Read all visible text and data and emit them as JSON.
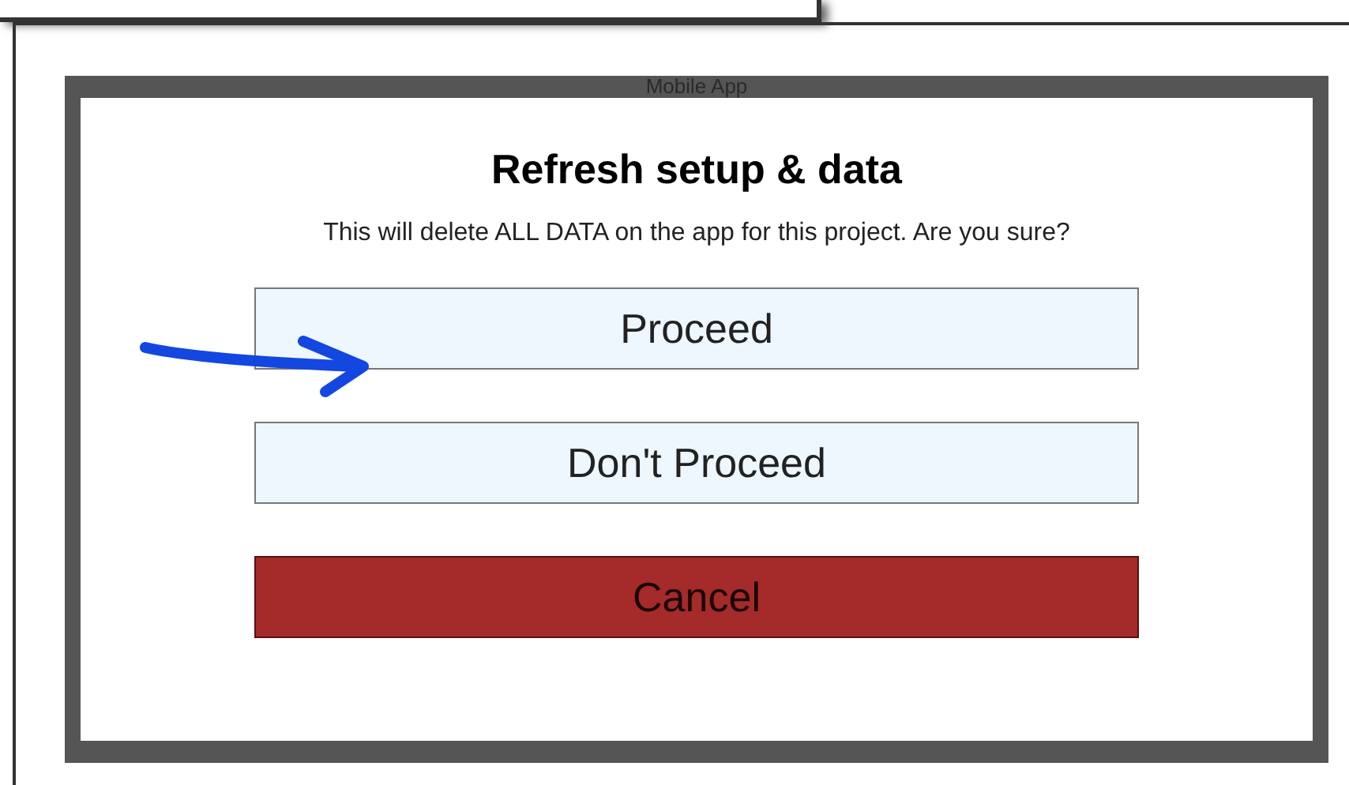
{
  "window": {
    "title": "Mobile App"
  },
  "dialog": {
    "title": "Refresh setup & data",
    "message": "This will delete ALL DATA on the app for this project. Are you sure?",
    "buttons": [
      {
        "label": "Proceed",
        "kind": "default"
      },
      {
        "label": "Don't Proceed",
        "kind": "default"
      },
      {
        "label": "Cancel",
        "kind": "danger"
      }
    ]
  }
}
